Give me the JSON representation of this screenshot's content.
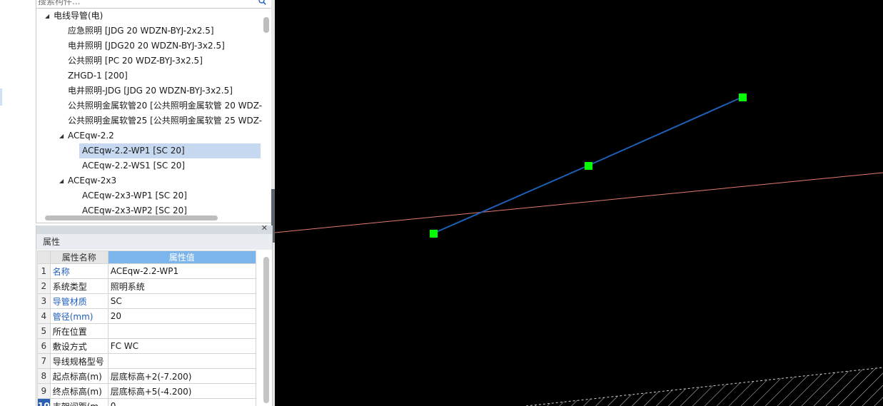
{
  "tree": {
    "search_placeholder": "搜索构件...",
    "items": [
      {
        "label": "电线导管(电)",
        "level": 0,
        "expanded": true
      },
      {
        "label": "应急照明 [JDG 20 WDZN-BYJ-2x2.5]",
        "level": 1
      },
      {
        "label": "电井照明 [JDG20 20 WDZN-BYJ-3x2.5]",
        "level": 1
      },
      {
        "label": "公共照明 [PC 20 WDZ-BYJ-3x2.5]",
        "level": 1
      },
      {
        "label": "ZHGD-1 [200]",
        "level": 1
      },
      {
        "label": "电井照明-JDG [JDG 20 WDZN-BYJ-3x2.5]",
        "level": 1
      },
      {
        "label": "公共照明金属软管20 [公共照明金属软管 20 WDZ-",
        "level": 1
      },
      {
        "label": "公共照明金属软管25 [公共照明金属软管 25 WDZ-",
        "level": 1
      },
      {
        "label": "ACEqw-2.2",
        "level": 1,
        "expanded": true
      },
      {
        "label": "ACEqw-2.2-WP1 [SC 20]",
        "level": 2,
        "selected": true
      },
      {
        "label": "ACEqw-2.2-WS1 [SC 20]",
        "level": 2
      },
      {
        "label": "ACEqw-2x3",
        "level": 1,
        "expanded": true
      },
      {
        "label": "ACEqw-2x3-WP1 [SC 20]",
        "level": 2
      },
      {
        "label": "ACEqw-2x3-WP2 [SC 20]",
        "level": 2
      }
    ]
  },
  "properties": {
    "title": "属性",
    "col_name": "属性名称",
    "col_value": "属性值",
    "rows": [
      {
        "num": "1",
        "name": "名称",
        "value": "ACEqw-2.2-WP1",
        "blue": true
      },
      {
        "num": "2",
        "name": "系统类型",
        "value": "照明系统",
        "blue": false
      },
      {
        "num": "3",
        "name": "导管材质",
        "value": "SC",
        "blue": true
      },
      {
        "num": "4",
        "name": "管径(mm)",
        "value": "20",
        "blue": true
      },
      {
        "num": "5",
        "name": "所在位置",
        "value": "",
        "blue": false
      },
      {
        "num": "6",
        "name": "敷设方式",
        "value": "FC WC",
        "blue": false
      },
      {
        "num": "7",
        "name": "导线规格型号",
        "value": "",
        "blue": false
      },
      {
        "num": "8",
        "name": "起点标高(m)",
        "value": "层底标高+2(-7.200)",
        "blue": false
      },
      {
        "num": "9",
        "name": "终点标高(m)",
        "value": "层底标高+5(-4.200)",
        "blue": false
      },
      {
        "num": "10",
        "name": "支架间距(m",
        "value": "0",
        "blue": false
      }
    ]
  },
  "colors": {
    "canvas_bg": "#000000",
    "pipe_line": "#1e5fb4",
    "grip_point": "#00ff00",
    "ref_line": "#e07a70",
    "hatch": "#d0d0d0",
    "selection": "#c6d9f1",
    "header_accent": "#7cb5ec"
  }
}
